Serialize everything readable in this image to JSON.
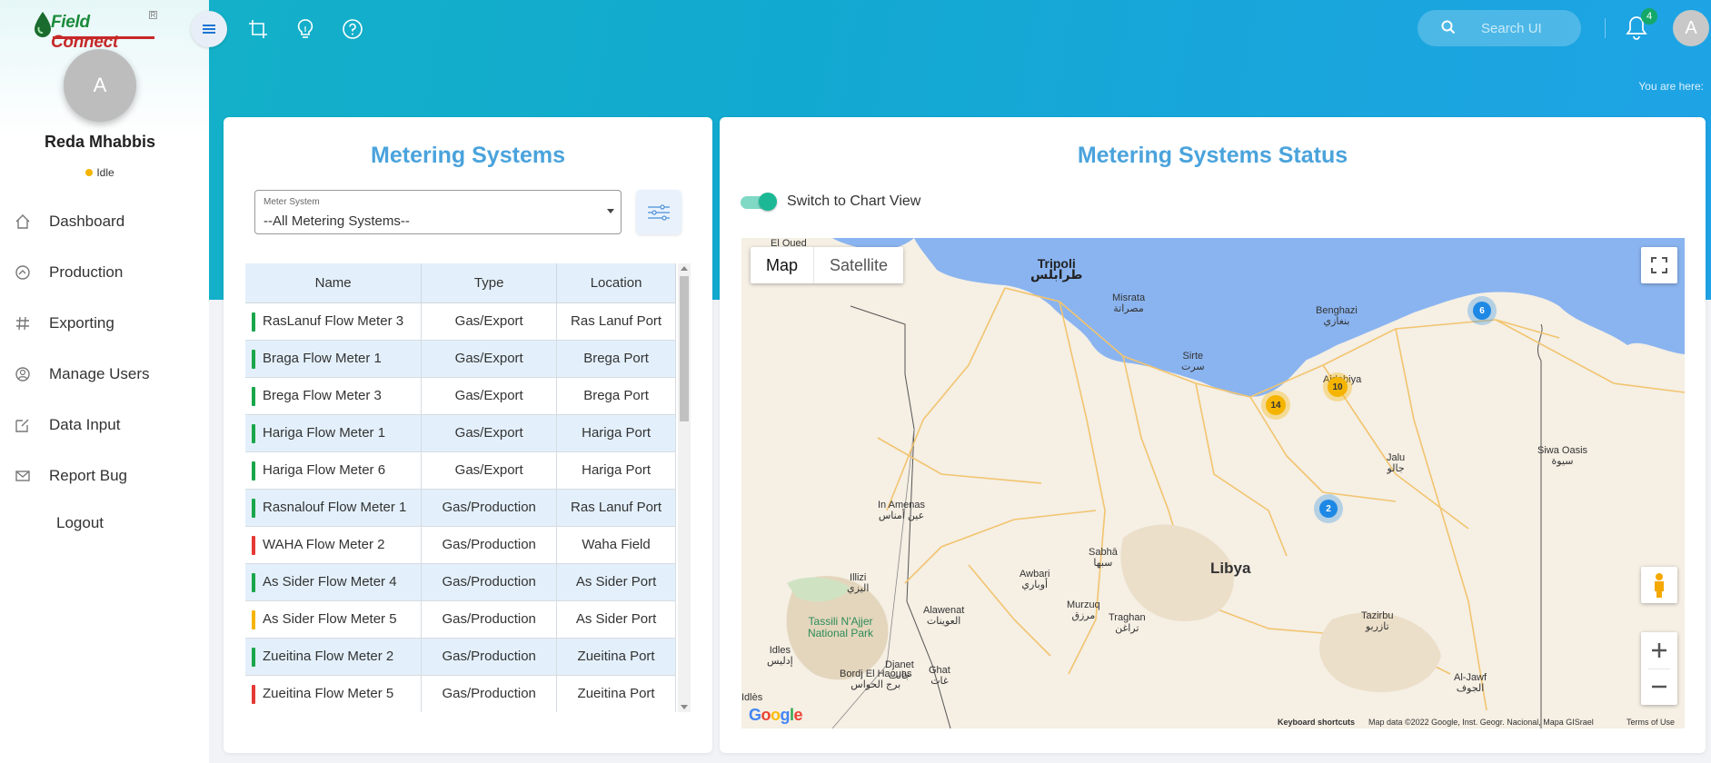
{
  "app": {
    "logo_text_a": "Field",
    "logo_text_b": "Connect",
    "logo_tm": "R"
  },
  "user": {
    "initial": "A",
    "name": "Reda Mhabbis",
    "status": "Idle"
  },
  "nav": {
    "items": [
      {
        "label": "Dashboard",
        "icon": "home-icon"
      },
      {
        "label": "Production",
        "icon": "gauge-icon"
      },
      {
        "label": "Exporting",
        "icon": "hash-icon"
      },
      {
        "label": "Manage Users",
        "icon": "users-icon"
      },
      {
        "label": "Data Input",
        "icon": "edit-icon"
      },
      {
        "label": "Report Bug",
        "icon": "mail-icon"
      }
    ],
    "logout": "Logout"
  },
  "header": {
    "search_placeholder": "Search UI",
    "notifications_count": "4",
    "avatar_initial": "A",
    "breadcrumb": "You are here:"
  },
  "left_card": {
    "title": "Metering Systems",
    "select_caption": "Meter System",
    "select_value": "--All Metering Systems--",
    "columns": [
      "Name",
      "Type",
      "Location"
    ],
    "rows": [
      {
        "name": "RasLanuf Flow Meter 3",
        "type": "Gas/Export",
        "location": "Ras Lanuf Port",
        "status_color": "#1aa64a"
      },
      {
        "name": "Braga Flow Meter 1",
        "type": "Gas/Export",
        "location": "Brega Port",
        "status_color": "#1aa64a"
      },
      {
        "name": "Brega Flow Meter 3",
        "type": "Gas/Export",
        "location": "Brega Port",
        "status_color": "#1aa64a"
      },
      {
        "name": "Hariga Flow Meter 1",
        "type": "Gas/Export",
        "location": "Hariga Port",
        "status_color": "#1aa64a"
      },
      {
        "name": "Hariga Flow Meter 6",
        "type": "Gas/Export",
        "location": "Hariga Port",
        "status_color": "#1aa64a"
      },
      {
        "name": "Rasnalouf Flow Meter 1",
        "type": "Gas/Production",
        "location": "Ras Lanuf Port",
        "status_color": "#1aa64a"
      },
      {
        "name": "WAHA Flow Meter 2",
        "type": "Gas/Production",
        "location": "Waha Field",
        "status_color": "#e53935"
      },
      {
        "name": "As Sider Flow Meter 4",
        "type": "Gas/Production",
        "location": "As Sider Port",
        "status_color": "#1aa64a"
      },
      {
        "name": "As Sider Flow Meter 5",
        "type": "Gas/Production",
        "location": "As Sider Port",
        "status_color": "#f5b400"
      },
      {
        "name": "Zueitina Flow Meter 2",
        "type": "Gas/Production",
        "location": "Zueitina Port",
        "status_color": "#1aa64a"
      },
      {
        "name": "Zueitina Flow Meter 5",
        "type": "Gas/Production",
        "location": "Zueitina Port",
        "status_color": "#e53935"
      }
    ]
  },
  "right_card": {
    "title": "Metering Systems Status",
    "toggle_label": "Switch to Chart View",
    "map": {
      "type_map": "Map",
      "type_satellite": "Satellite",
      "country": "Libya",
      "cities": [
        {
          "name": "Tripoli",
          "arabic": "طرابلس",
          "major": true
        },
        {
          "name": "Misrata",
          "arabic": "مصراتة",
          "major": false
        },
        {
          "name": "Sirte",
          "arabic": "سرت",
          "major": false
        },
        {
          "name": "Benghazi",
          "arabic": "بنغازي",
          "major": false
        },
        {
          "name": "Ajdabiya",
          "arabic": "",
          "major": false
        },
        {
          "name": "Jalu",
          "arabic": "جالو",
          "major": false
        },
        {
          "name": "Siwa Oasis",
          "arabic": "سيوة",
          "major": false
        },
        {
          "name": "In Amenas",
          "arabic": "عين أمناس",
          "major": false
        },
        {
          "name": "Sabhā",
          "arabic": "سبها",
          "major": false
        },
        {
          "name": "Awbari",
          "arabic": "أوباري",
          "major": false
        },
        {
          "name": "Illizi",
          "arabic": "اليزي",
          "major": false
        },
        {
          "name": "Alawenat",
          "arabic": "العوينات",
          "major": false
        },
        {
          "name": "Murzuq",
          "arabic": "مرزق",
          "major": false
        },
        {
          "name": "Traghan",
          "arabic": "تراغن",
          "major": false
        },
        {
          "name": "Tazirbu",
          "arabic": "تازربو",
          "major": false
        },
        {
          "name": "Idles",
          "arabic": "إدليس",
          "major": false
        },
        {
          "name": "Djanet",
          "arabic": "جانت",
          "major": false
        },
        {
          "name": "Ghat",
          "arabic": "غات",
          "major": false
        },
        {
          "name": "Bordj El Haouas",
          "arabic": "برج الحواس",
          "major": false
        },
        {
          "name": "Al-Jawf",
          "arabic": "الجوف",
          "major": false
        },
        {
          "name": "Idlès",
          "arabic": "",
          "major": false
        },
        {
          "name": "El Oued",
          "arabic": "",
          "major": false
        }
      ],
      "park": "Tassili N'Ajjer National Park",
      "clusters": [
        {
          "count": "14",
          "color": "#f5b400"
        },
        {
          "count": "10",
          "color": "#f5b400"
        },
        {
          "count": "6",
          "color": "#1e88e5"
        },
        {
          "count": "2",
          "color": "#1e88e5"
        }
      ],
      "google_logo": "Google",
      "footer_shortcuts": "Keyboard shortcuts",
      "footer_data": "Map data ©2022 Google, Inst. Geogr. Nacional, Mapa GISrael",
      "footer_terms": "Terms of Use"
    }
  },
  "colors": {
    "accent": "#4aa3dc",
    "header_gradient_start": "#14b3c6",
    "header_gradient_end": "#1fa3e6",
    "toggle": "#1cb896",
    "ok": "#1aa64a",
    "warning": "#f5b400",
    "error": "#e53935"
  }
}
